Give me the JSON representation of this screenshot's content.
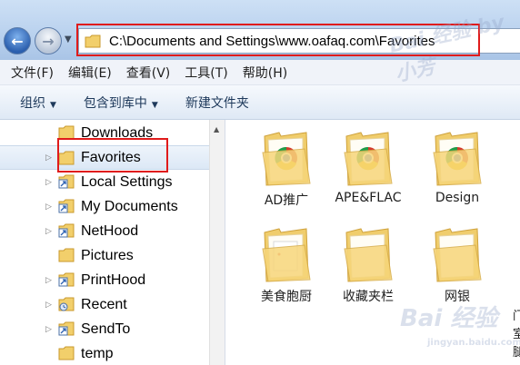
{
  "address": {
    "path": "C:\\Documents and Settings\\www.oafaq.com\\Favorites"
  },
  "menu": [
    "文件(F)",
    "编辑(E)",
    "查看(V)",
    "工具(T)",
    "帮助(H)"
  ],
  "commands": {
    "organize": "组织",
    "include_in_library": "包含到库中",
    "new_folder": "新建文件夹"
  },
  "tree": [
    {
      "label": "Downloads",
      "expandable": false,
      "icon": "folder-icon"
    },
    {
      "label": "Favorites",
      "expandable": true,
      "icon": "folder-icon",
      "selected": true
    },
    {
      "label": "Local Settings",
      "expandable": true,
      "icon": "shortcut-folder-icon"
    },
    {
      "label": "My Documents",
      "expandable": true,
      "icon": "shortcut-folder-icon"
    },
    {
      "label": "NetHood",
      "expandable": true,
      "icon": "shortcut-folder-icon"
    },
    {
      "label": "Pictures",
      "expandable": false,
      "icon": "folder-icon"
    },
    {
      "label": "PrintHood",
      "expandable": true,
      "icon": "shortcut-folder-icon"
    },
    {
      "label": "Recent",
      "expandable": true,
      "icon": "recent-folder-icon"
    },
    {
      "label": "SendTo",
      "expandable": true,
      "icon": "shortcut-folder-icon"
    },
    {
      "label": "temp",
      "expandable": false,
      "icon": "folder-icon"
    }
  ],
  "items": [
    {
      "label": "AD推广",
      "icon": "chrome-folder-icon"
    },
    {
      "label": "APE&FLAC",
      "icon": "chrome-folder-icon"
    },
    {
      "label": "Design",
      "icon": "chrome-folder-icon"
    },
    {
      "label": "美食胞厨",
      "icon": "document-folder-icon"
    },
    {
      "label": "收藏夹栏",
      "icon": "folder-icon"
    },
    {
      "label": "网银",
      "icon": "folder-icon"
    }
  ],
  "partial_text": [
    "门",
    "室",
    "腿"
  ],
  "watermark": {
    "text": "Bai 经验",
    "sub": "jingyan.baidu.com",
    "top": "Bai 经验 by 小芳"
  },
  "colors": {
    "highlight": "#e01b1b",
    "folder": "#f2cf6b"
  }
}
